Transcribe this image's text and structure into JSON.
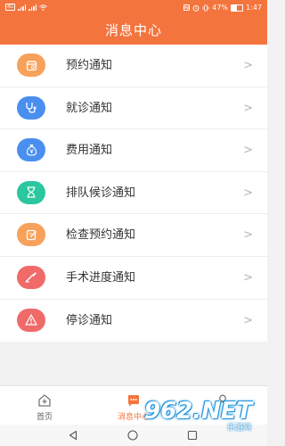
{
  "status_bar": {
    "left_indicator": "4G",
    "battery_percent": "47%",
    "battery_level": 0.47,
    "time": "1:47"
  },
  "header": {
    "title": "消息中心"
  },
  "menu": {
    "items": [
      {
        "label": "预约通知",
        "icon": "calendar-icon",
        "color": "#f7a15b"
      },
      {
        "label": "就诊通知",
        "icon": "stethoscope-icon",
        "color": "#4a8ff0"
      },
      {
        "label": "费用通知",
        "icon": "money-bag-icon",
        "color": "#4a8ff0"
      },
      {
        "label": "排队候诊通知",
        "icon": "hourglass-icon",
        "color": "#2bc79e"
      },
      {
        "label": "检查预约通知",
        "icon": "edit-icon",
        "color": "#f7a15b"
      },
      {
        "label": "手术进度通知",
        "icon": "scalpel-icon",
        "color": "#f06a6a"
      },
      {
        "label": "停诊通知",
        "icon": "warning-icon",
        "color": "#f06a6a"
      }
    ],
    "chevron": ">"
  },
  "bottom_nav": {
    "tabs": [
      {
        "label": "首页",
        "icon": "home-icon",
        "active": false
      },
      {
        "label": "消息中心",
        "icon": "message-icon",
        "active": true
      },
      {
        "label": "",
        "icon": "profile-icon",
        "active": false
      }
    ]
  },
  "watermark": {
    "text": "962.NET",
    "subtext": "乐游网"
  },
  "colors": {
    "accent": "#f4743e"
  }
}
